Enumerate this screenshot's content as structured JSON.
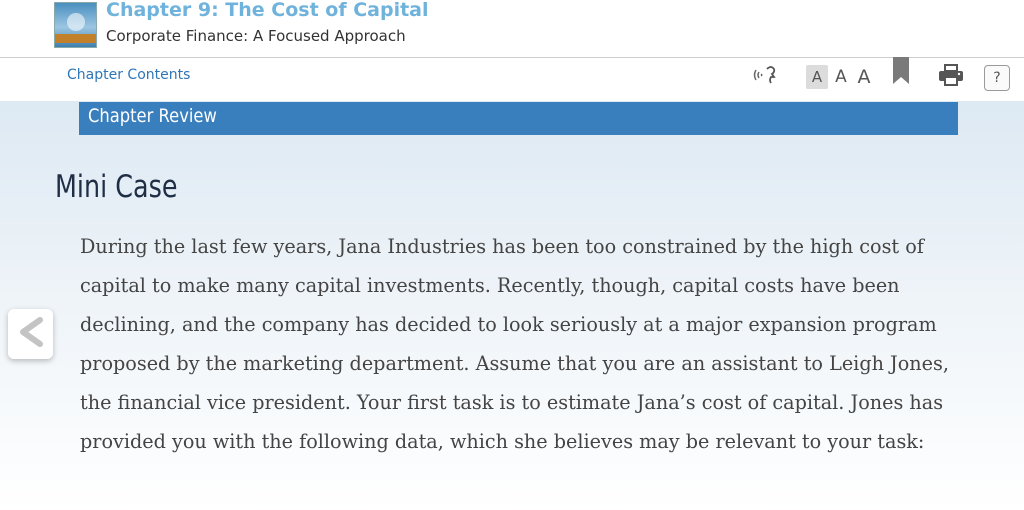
{
  "header": {
    "chapter_title": "Chapter 9: The Cost of Capital",
    "book_title": "Corporate Finance: A Focused Approach"
  },
  "toolbar": {
    "chapter_contents": "Chapter Contents",
    "font_small": "A",
    "font_medium": "A",
    "font_large": "A",
    "help": "?",
    "icons": [
      "audio-icon",
      "bookmark-icon",
      "print-icon",
      "help-icon"
    ]
  },
  "content": {
    "section_label": "Chapter Review",
    "heading": "Mini Case",
    "body": "During the last few years, Jana Industries has been too constrained by the high cost of capital to make many capital investments. Recently, though, capital costs have been declining, and the company has decided to look seriously at a major expansion program proposed by the marketing department. Assume that you are an assistant to Leigh Jones, the financial vice president. Your first task is to estimate Jana’s cost of capital. Jones has provided you with the following data, which she believes may be relevant to your task:"
  },
  "navigation": {
    "back_icon": "chevron-left-icon"
  },
  "colors": {
    "section_bar": "#3a7fbd",
    "chapter_title": "#6fb3dc",
    "link": "#2f76b7",
    "heading": "#1f2e45",
    "body_text": "#444444",
    "content_background_top": "#dde9f3"
  }
}
